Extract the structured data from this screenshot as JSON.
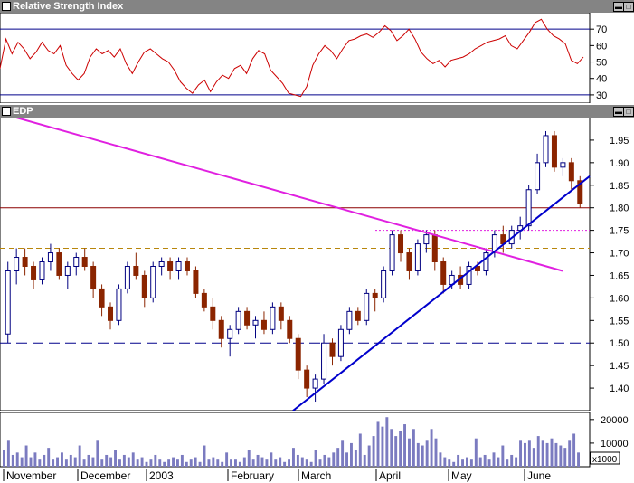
{
  "rsi_panel": {
    "title": "Relative Strength Index",
    "y_ticks": [
      "70",
      "60",
      "50",
      "40",
      "30"
    ]
  },
  "price_panel": {
    "title": "EDP",
    "y_ticks": [
      "1.95",
      "1.90",
      "1.85",
      "1.80",
      "1.75",
      "1.70",
      "1.65",
      "1.60",
      "1.55",
      "1.50",
      "1.45",
      "1.40"
    ]
  },
  "volume_panel": {
    "y_ticks": [
      "20000",
      "10000"
    ],
    "unit_box": "x1000"
  },
  "x_axis": {
    "months": [
      "November",
      "December",
      "2003",
      "February",
      "March",
      "April",
      "May",
      "June"
    ]
  },
  "colors": {
    "up_candle": "#000080",
    "down_candle": "#8b2500",
    "rsi_line": "#cc0000",
    "trend_down": "#e020e0",
    "trend_up": "#0000cc",
    "volume_bar": "#7b7bc0",
    "panel_title_bg": "#848484"
  },
  "chart_data": [
    {
      "type": "line",
      "title": "Relative Strength Index",
      "ylim": [
        25,
        80
      ],
      "reference_lines": [
        30,
        50,
        70
      ],
      "series": [
        {
          "values": [
            46,
            64,
            55,
            62,
            58,
            52,
            56,
            62,
            57,
            55,
            60,
            48,
            43,
            39,
            43,
            53,
            58,
            55,
            57,
            53,
            58,
            49,
            43,
            50,
            56,
            58,
            55,
            52,
            50,
            45,
            38,
            34,
            31,
            36,
            39,
            32,
            38,
            42,
            40,
            46,
            48,
            43,
            52,
            57,
            55,
            45,
            41,
            37,
            31,
            30,
            29,
            35,
            48,
            55,
            60,
            57,
            52,
            58,
            63,
            64,
            66,
            67,
            65,
            68,
            72,
            69,
            63,
            66,
            70,
            64,
            56,
            52,
            49,
            51,
            47,
            51,
            52,
            53,
            55,
            58,
            60,
            62,
            63,
            64,
            66,
            60,
            58,
            63,
            68,
            74,
            76,
            70,
            66,
            64,
            61,
            51,
            49,
            53
          ]
        }
      ]
    },
    {
      "type": "candlestick",
      "title": "EDP",
      "ylim": [
        1.35,
        2.0
      ],
      "ohlc": [
        [
          1.52,
          1.68,
          1.5,
          1.66
        ],
        [
          1.66,
          1.71,
          1.63,
          1.69
        ],
        [
          1.69,
          1.71,
          1.65,
          1.67
        ],
        [
          1.67,
          1.68,
          1.62,
          1.64
        ],
        [
          1.64,
          1.69,
          1.63,
          1.68
        ],
        [
          1.68,
          1.72,
          1.66,
          1.7
        ],
        [
          1.7,
          1.71,
          1.64,
          1.65
        ],
        [
          1.65,
          1.68,
          1.62,
          1.67
        ],
        [
          1.67,
          1.7,
          1.65,
          1.69
        ],
        [
          1.69,
          1.71,
          1.66,
          1.67
        ],
        [
          1.67,
          1.68,
          1.6,
          1.62
        ],
        [
          1.62,
          1.63,
          1.56,
          1.58
        ],
        [
          1.58,
          1.59,
          1.53,
          1.55
        ],
        [
          1.55,
          1.63,
          1.54,
          1.62
        ],
        [
          1.62,
          1.68,
          1.61,
          1.67
        ],
        [
          1.67,
          1.7,
          1.64,
          1.65
        ],
        [
          1.65,
          1.66,
          1.58,
          1.6
        ],
        [
          1.6,
          1.68,
          1.59,
          1.67
        ],
        [
          1.67,
          1.69,
          1.65,
          1.68
        ],
        [
          1.68,
          1.69,
          1.64,
          1.66
        ],
        [
          1.66,
          1.69,
          1.64,
          1.68
        ],
        [
          1.68,
          1.69,
          1.65,
          1.66
        ],
        [
          1.66,
          1.67,
          1.6,
          1.61
        ],
        [
          1.61,
          1.62,
          1.57,
          1.58
        ],
        [
          1.58,
          1.6,
          1.53,
          1.55
        ],
        [
          1.55,
          1.56,
          1.49,
          1.51
        ],
        [
          1.51,
          1.54,
          1.47,
          1.53
        ],
        [
          1.53,
          1.58,
          1.52,
          1.57
        ],
        [
          1.57,
          1.58,
          1.53,
          1.54
        ],
        [
          1.54,
          1.56,
          1.51,
          1.55
        ],
        [
          1.55,
          1.57,
          1.52,
          1.53
        ],
        [
          1.53,
          1.59,
          1.52,
          1.58
        ],
        [
          1.58,
          1.59,
          1.53,
          1.55
        ],
        [
          1.55,
          1.56,
          1.5,
          1.51
        ],
        [
          1.51,
          1.52,
          1.42,
          1.44
        ],
        [
          1.44,
          1.45,
          1.38,
          1.4
        ],
        [
          1.4,
          1.43,
          1.37,
          1.42
        ],
        [
          1.42,
          1.52,
          1.41,
          1.5
        ],
        [
          1.5,
          1.51,
          1.45,
          1.47
        ],
        [
          1.47,
          1.54,
          1.46,
          1.53
        ],
        [
          1.53,
          1.58,
          1.52,
          1.57
        ],
        [
          1.57,
          1.58,
          1.54,
          1.55
        ],
        [
          1.55,
          1.62,
          1.54,
          1.61
        ],
        [
          1.61,
          1.62,
          1.57,
          1.6
        ],
        [
          1.6,
          1.67,
          1.59,
          1.66
        ],
        [
          1.66,
          1.75,
          1.65,
          1.74
        ],
        [
          1.74,
          1.75,
          1.68,
          1.7
        ],
        [
          1.7,
          1.71,
          1.64,
          1.66
        ],
        [
          1.66,
          1.73,
          1.65,
          1.72
        ],
        [
          1.72,
          1.75,
          1.7,
          1.74
        ],
        [
          1.74,
          1.75,
          1.66,
          1.68
        ],
        [
          1.68,
          1.69,
          1.61,
          1.63
        ],
        [
          1.63,
          1.66,
          1.62,
          1.65
        ],
        [
          1.65,
          1.67,
          1.62,
          1.63
        ],
        [
          1.63,
          1.68,
          1.62,
          1.67
        ],
        [
          1.67,
          1.68,
          1.65,
          1.66
        ],
        [
          1.66,
          1.71,
          1.65,
          1.7
        ],
        [
          1.7,
          1.75,
          1.69,
          1.74
        ],
        [
          1.74,
          1.76,
          1.7,
          1.72
        ],
        [
          1.72,
          1.76,
          1.71,
          1.75
        ],
        [
          1.75,
          1.78,
          1.73,
          1.76
        ],
        [
          1.76,
          1.85,
          1.75,
          1.84
        ],
        [
          1.84,
          1.92,
          1.83,
          1.9
        ],
        [
          1.9,
          1.97,
          1.89,
          1.96
        ],
        [
          1.96,
          1.97,
          1.88,
          1.89
        ],
        [
          1.89,
          1.91,
          1.87,
          1.9
        ],
        [
          1.9,
          1.91,
          1.84,
          1.86
        ],
        [
          1.86,
          1.87,
          1.8,
          1.81
        ]
      ],
      "reference_lines": [
        1.8,
        1.75,
        1.71,
        1.5
      ],
      "trend_lines": [
        {
          "color": "magenta",
          "values": [
            2.0,
            1.66
          ]
        },
        {
          "color": "blue",
          "values": [
            1.35,
            1.87
          ]
        }
      ]
    },
    {
      "type": "bar",
      "title": "Volume",
      "unit": "x1000",
      "ylim": [
        0,
        23000
      ],
      "values": [
        7000,
        11000,
        5000,
        6000,
        4000,
        9000,
        4000,
        6000,
        3000,
        5000,
        8000,
        3000,
        4000,
        6000,
        3000,
        5000,
        4000,
        9000,
        3000,
        5000,
        4000,
        11000,
        3000,
        5000,
        4000,
        7000,
        3000,
        5000,
        4000,
        6000,
        3000,
        4000,
        2000,
        3000,
        5000,
        3000,
        2000,
        3000,
        4000,
        3000,
        5000,
        2000,
        3000,
        4000,
        2000,
        9000,
        3000,
        4000,
        3000,
        2000,
        6000,
        3000,
        3000,
        2000,
        4000,
        7000,
        3000,
        5000,
        4000,
        3000,
        6000,
        3000,
        4000,
        2000,
        3000,
        8000,
        5000,
        4000,
        3000,
        2000,
        7000,
        3000,
        5000,
        4000,
        6000,
        8000,
        11000,
        6000,
        10000,
        7000,
        14000,
        5000,
        9000,
        13000,
        19000,
        17000,
        21000,
        16000,
        13000,
        15000,
        18000,
        12000,
        16000,
        10000,
        9000,
        11000,
        16000,
        12000,
        6000,
        4000,
        3000,
        2000,
        5000,
        3000,
        4000,
        3000,
        12000,
        4000,
        5000,
        3000,
        6000,
        4000,
        9000,
        3000,
        5000,
        4000,
        11000,
        10000,
        11000,
        8000,
        13000,
        11000,
        10000,
        12000,
        10000,
        9000,
        8000,
        11000,
        14000,
        6000
      ]
    }
  ]
}
